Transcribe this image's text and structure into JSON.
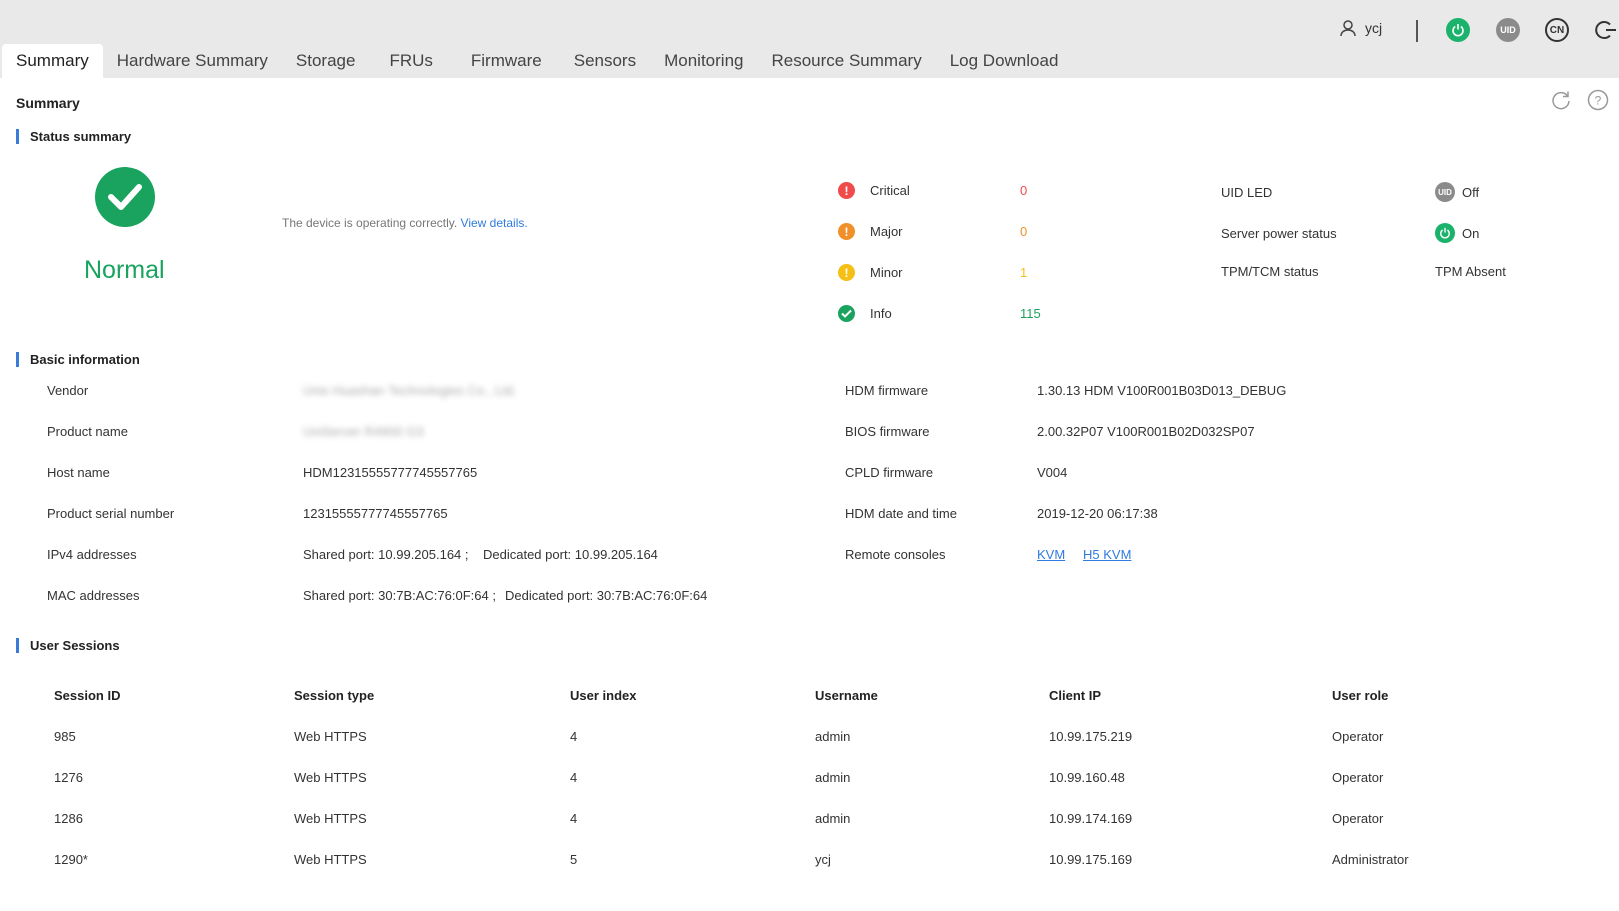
{
  "header": {
    "username": "ycj",
    "uid_label": "UID",
    "lang_label": "CN"
  },
  "tabs": [
    "Summary",
    "Hardware Summary",
    "Storage",
    "FRUs",
    "Firmware",
    "Sensors",
    "Monitoring",
    "Resource Summary",
    "Log Download"
  ],
  "page": {
    "title": "Summary"
  },
  "status_summary": {
    "section_title": "Status summary",
    "overall": "Normal",
    "description": "The device is operating correctly.",
    "details_link": "View details.",
    "alarms": [
      {
        "label": "Critical",
        "count": "0",
        "color": "#f04b4b",
        "icon": "exclamation-icon"
      },
      {
        "label": "Major",
        "count": "0",
        "color": "#f0902a",
        "icon": "exclamation-icon"
      },
      {
        "label": "Minor",
        "count": "1",
        "color": "#f5bf15",
        "icon": "exclamation-icon"
      },
      {
        "label": "Info",
        "count": "115",
        "color": "#1aa35e",
        "icon": "check-icon"
      }
    ],
    "uid_led": {
      "label": "UID LED",
      "badge": "UID",
      "value": "Off"
    },
    "power": {
      "label": "Server power status",
      "value": "On"
    },
    "tpm": {
      "label": "TPM/TCM status",
      "value": "TPM Absent"
    }
  },
  "basic_info": {
    "section_title": "Basic information",
    "vendor": {
      "label": "Vendor",
      "value": "Unis Huashan Technologies Co., Ltd."
    },
    "product_name": {
      "label": "Product name",
      "value": "UniServer R4900 G3"
    },
    "host_name": {
      "label": "Host name",
      "value": "HDM12315555777745557765"
    },
    "serial": {
      "label": "Product serial number",
      "value": "12315555777745557765"
    },
    "ipv4": {
      "label": "IPv4 addresses",
      "shared": "Shared port: 10.99.205.164 ;",
      "dedicated": "Dedicated port: 10.99.205.164"
    },
    "mac": {
      "label": "MAC addresses",
      "shared": "Shared port: 30:7B:AC:76:0F:64 ;",
      "dedicated": "Dedicated port: 30:7B:AC:76:0F:64"
    },
    "hdm_fw": {
      "label": "HDM firmware",
      "value": "1.30.13 HDM V100R001B03D013_DEBUG"
    },
    "bios_fw": {
      "label": "BIOS firmware",
      "value": "2.00.32P07 V100R001B02D032SP07"
    },
    "cpld_fw": {
      "label": "CPLD firmware",
      "value": "V004"
    },
    "datetime": {
      "label": "HDM date and time",
      "value": "2019-12-20 06:17:38"
    },
    "consoles": {
      "label": "Remote consoles",
      "kvm": "KVM",
      "h5kvm": "H5 KVM"
    }
  },
  "sessions": {
    "section_title": "User Sessions",
    "columns": [
      "Session ID",
      "Session type",
      "User index",
      "Username",
      "Client IP",
      "User role"
    ],
    "rows": [
      [
        "985",
        "Web HTTPS",
        "4",
        "admin",
        "10.99.175.219",
        "Operator"
      ],
      [
        "1276",
        "Web HTTPS",
        "4",
        "admin",
        "10.99.160.48",
        "Operator"
      ],
      [
        "1286",
        "Web HTTPS",
        "4",
        "admin",
        "10.99.174.169",
        "Operator"
      ],
      [
        "1290*",
        "Web HTTPS",
        "5",
        "ycj",
        "10.99.175.169",
        "Administrator"
      ]
    ]
  }
}
